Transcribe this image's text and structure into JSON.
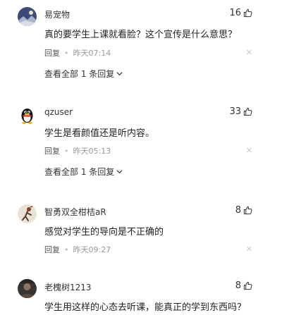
{
  "comments": [
    {
      "username": "易宠物",
      "likes": "16",
      "content": "真的要学生上课就看脸？这个宣传是什么意思？",
      "reply_label": "回复",
      "time": "昨天07:14",
      "view_replies": "查看全部 1 条回复",
      "avatar_icon": "landscape-avatar-icon"
    },
    {
      "username": "qzuser",
      "likes": "33",
      "content": "学生是看颜值还是听内容。",
      "reply_label": "回复",
      "time": "昨天05:13",
      "view_replies": "查看全部 1 条回复",
      "avatar_icon": "penguin-avatar-icon"
    },
    {
      "username": "智勇双全柑桔aR",
      "likes": "8",
      "content": "感觉对学生的导向是不正确的",
      "reply_label": "回复",
      "time": "昨天09:27",
      "avatar_icon": "figure-avatar-icon"
    },
    {
      "username": "老槐树1213",
      "likes": "8",
      "content": "学生用这样的心态去听课，能真正的学到东西吗？",
      "avatar_icon": "dark-photo-avatar-icon"
    }
  ],
  "colors": {
    "text": "#222222",
    "muted": "#999999",
    "close": "#c8c8c8"
  }
}
